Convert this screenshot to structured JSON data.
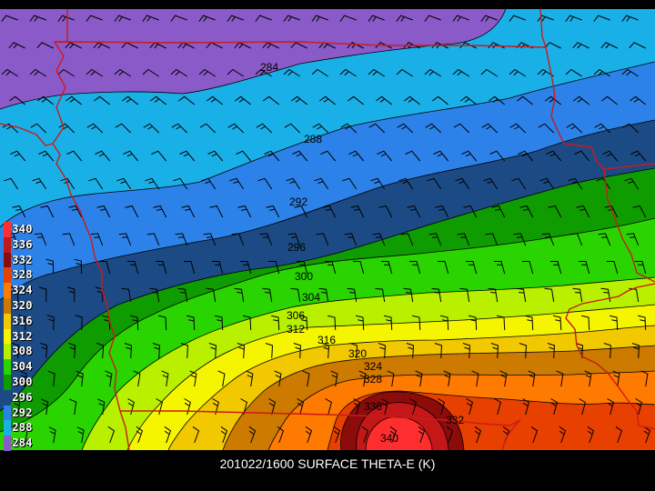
{
  "caption": "201022/1600 SURFACE THETA-E (K)",
  "legend": [
    {
      "label": "340",
      "color": "#ff2e2e"
    },
    {
      "label": "336",
      "color": "#c41818"
    },
    {
      "label": "332",
      "color": "#8c0c0c"
    },
    {
      "label": "328",
      "color": "#e84000"
    },
    {
      "label": "324",
      "color": "#ff7a00"
    },
    {
      "label": "320",
      "color": "#cc7a00"
    },
    {
      "label": "316",
      "color": "#f2c800"
    },
    {
      "label": "312",
      "color": "#f5f500"
    },
    {
      "label": "308",
      "color": "#b8f000"
    },
    {
      "label": "304",
      "color": "#29d400"
    },
    {
      "label": "300",
      "color": "#0f9c00"
    },
    {
      "label": "296",
      "color": "#1c4a84"
    },
    {
      "label": "292",
      "color": "#2c82e8"
    },
    {
      "label": "288",
      "color": "#19b0e8"
    },
    {
      "label": "284",
      "color": "#8a5ac8"
    }
  ],
  "contour_labels": [
    {
      "text": "284"
    },
    {
      "text": "288"
    },
    {
      "text": "292"
    },
    {
      "text": "296"
    },
    {
      "text": "300"
    },
    {
      "text": "304"
    },
    {
      "text": "306"
    },
    {
      "text": "312"
    },
    {
      "text": "316"
    },
    {
      "text": "320"
    },
    {
      "text": "324"
    },
    {
      "text": "328"
    },
    {
      "text": "336"
    },
    {
      "text": "332"
    },
    {
      "text": "340"
    }
  ],
  "colors": {
    "boundary": "#cc1a1a",
    "wind_barb": "#000000",
    "contour": "#000000"
  }
}
